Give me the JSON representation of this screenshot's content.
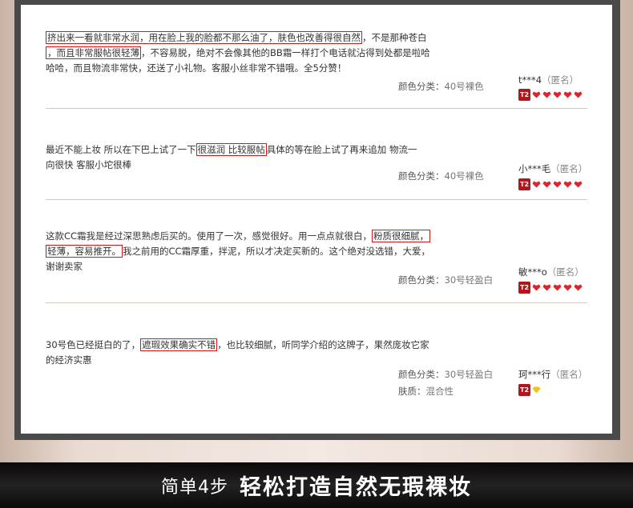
{
  "reviews": [
    {
      "parts": [
        "挤出来一看就非常水润，用在脸上我的脸都不那么油了，肤色也改善得很自然",
        "，不是那种苍白",
        "，而且非常服帖很轻薄",
        "，不容易脱，绝对不会像其他的BB霜一样打个电话就沾得到处都是啦哈",
        "哈哈，而且物流非常快，还送了小礼物。客服小丝非常不错哦。全5分赞！"
      ],
      "spec_label": "颜色分类：",
      "spec_value": "40号裸色",
      "user": "t***4",
      "anon": "（匿名）",
      "level": "T2"
    },
    {
      "parts": [
        "最近不能上妆 所以在下巴上试了一下",
        "很滋润 比较服帖",
        "具体的等在脸上试了再来追加 物流一",
        "向很快 客服小坨很棒"
      ],
      "spec_label": "颜色分类：",
      "spec_value": "40号裸色",
      "user": "小***毛",
      "anon": "（匿名）",
      "level": "T2"
    },
    {
      "parts": [
        "这款CC霜我是经过深思熟虑后买的。使用了一次，感觉很好。用一点点就很白，",
        "粉质很细腻，",
        "轻薄，容易推开。",
        "我之前用的CC霜厚重，拌泥，所以才决定买新的。这个绝对没选错，大爱，",
        "谢谢卖家"
      ],
      "spec_label": "颜色分类：",
      "spec_value": "30号轻盈白",
      "user": "敏***o",
      "anon": "（匿名）",
      "level": "T2"
    },
    {
      "parts": [
        "30号色已经挺白的了，",
        "遮瑕效果确实不错",
        "，也比较细腻，听同学介绍的这牌子，果然庞妆它家",
        "的经济实惠"
      ],
      "spec_label": "颜色分类：",
      "spec_value": "30号轻盈白",
      "spec2_label": "肤质：",
      "spec2_value": "混合性",
      "user": "珂***行",
      "anon": "（匿名）",
      "level": "T2"
    }
  ],
  "footer": {
    "small": "简单4步",
    "big": "轻松打造自然无瑕裸妆"
  },
  "colors": {
    "highlight_border": "#d21818",
    "level_badge": "#b3151c",
    "heart_gem": "#e0242b",
    "diamond_gem": "#f2c414"
  }
}
